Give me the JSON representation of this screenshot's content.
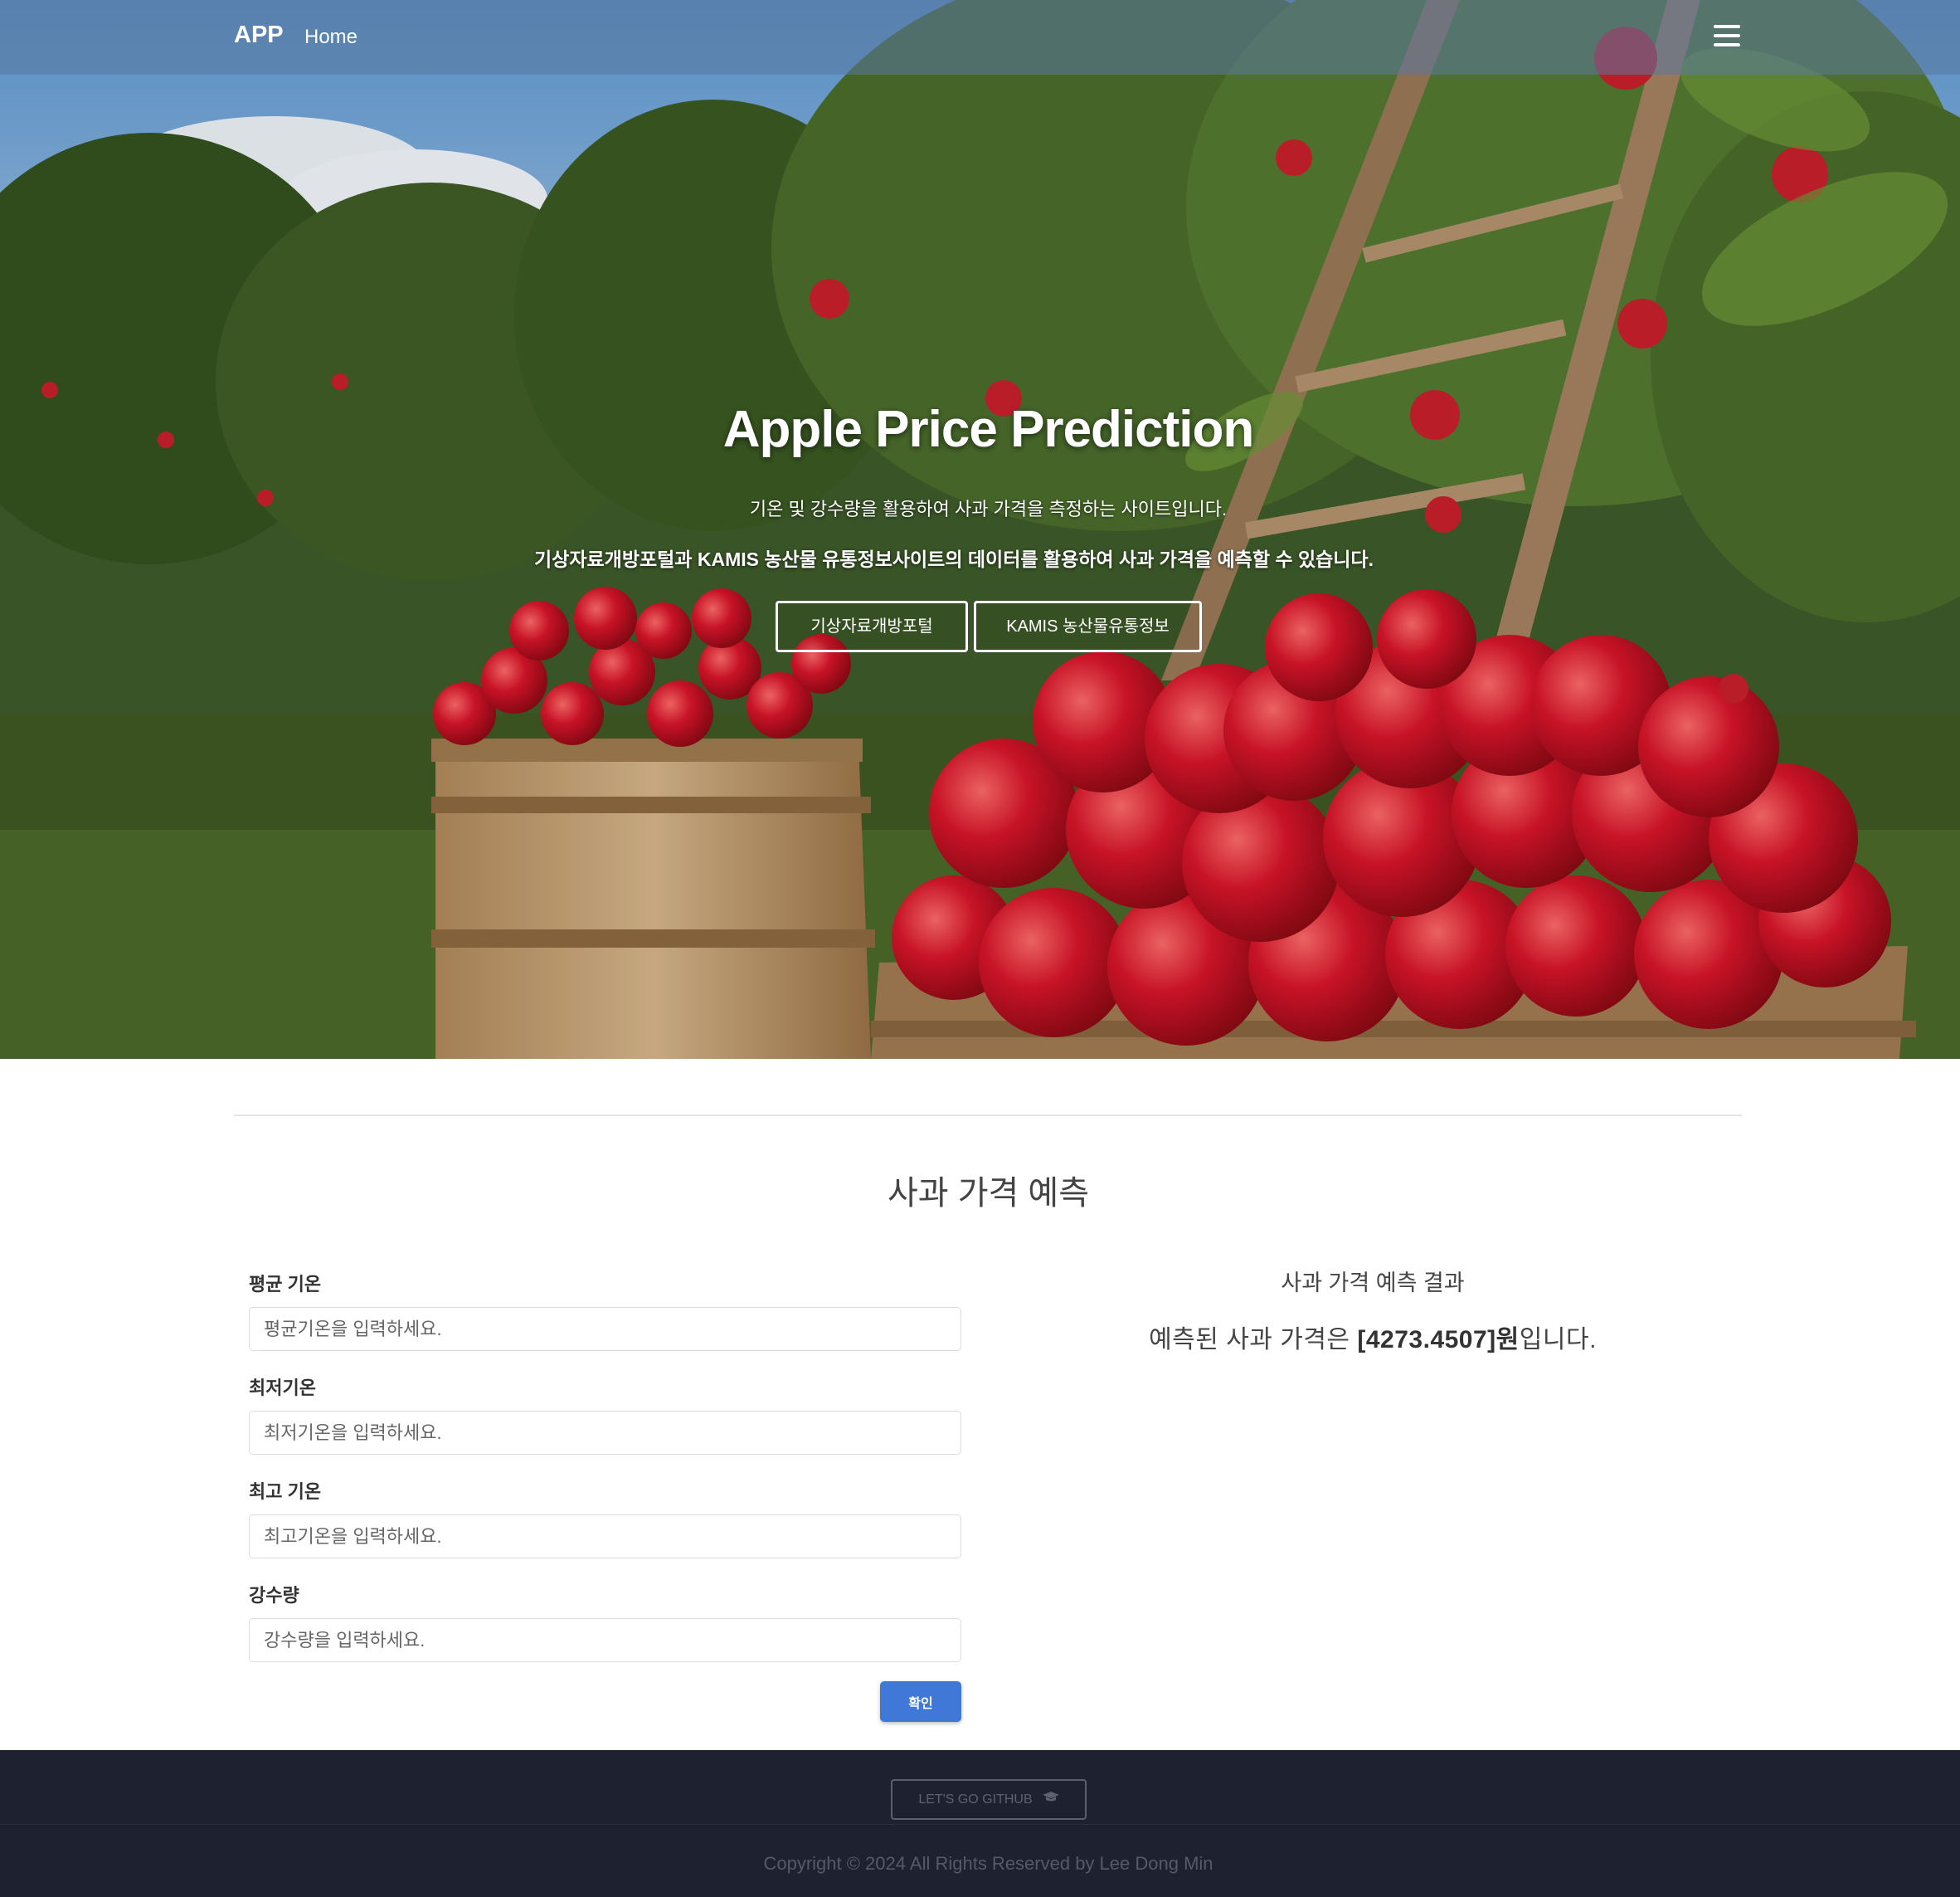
{
  "nav": {
    "brand": "APP",
    "home": "Home"
  },
  "hero": {
    "title": "Apple Price Prediction",
    "subtitle1": "기온 및 강수량을 활용하여 사과 가격을 측정하는 사이트입니다.",
    "subtitle2": "기상자료개방포털과 KAMIS 농산물 유통정보사이트의 데이터를 활용하여 사과 가격을 예측할 수 있습니다.",
    "btn_kma": "기상자료개방포털",
    "btn_kamis": "KAMIS 농산물유통정보"
  },
  "form": {
    "section_title": "사과 가격 예측",
    "fields": [
      {
        "label": "평균 기온",
        "placeholder": "평균기온을 입력하세요."
      },
      {
        "label": "최저기온",
        "placeholder": "최저기온을 입력하세요."
      },
      {
        "label": "최고 기온",
        "placeholder": "최고기온을 입력하세요."
      },
      {
        "label": "강수량",
        "placeholder": "강수량을 입력하세요."
      }
    ],
    "submit": "확인"
  },
  "result": {
    "title": "사과 가격 예측 결과",
    "prefix": "예측된 사과 가격은 ",
    "value": "[4273.4507]원",
    "suffix": "입니다."
  },
  "footer": {
    "github": "LET'S GO GITHUB",
    "github_icon": "graduation-cap-icon",
    "copyright": "Copyright © 2024 All Rights Reserved by Lee Dong Min"
  },
  "colors": {
    "primary_button": "#3f78d6",
    "footer_bg": "#1e2230",
    "navbar_bg": "rgba(90,120,160,0.55)"
  }
}
